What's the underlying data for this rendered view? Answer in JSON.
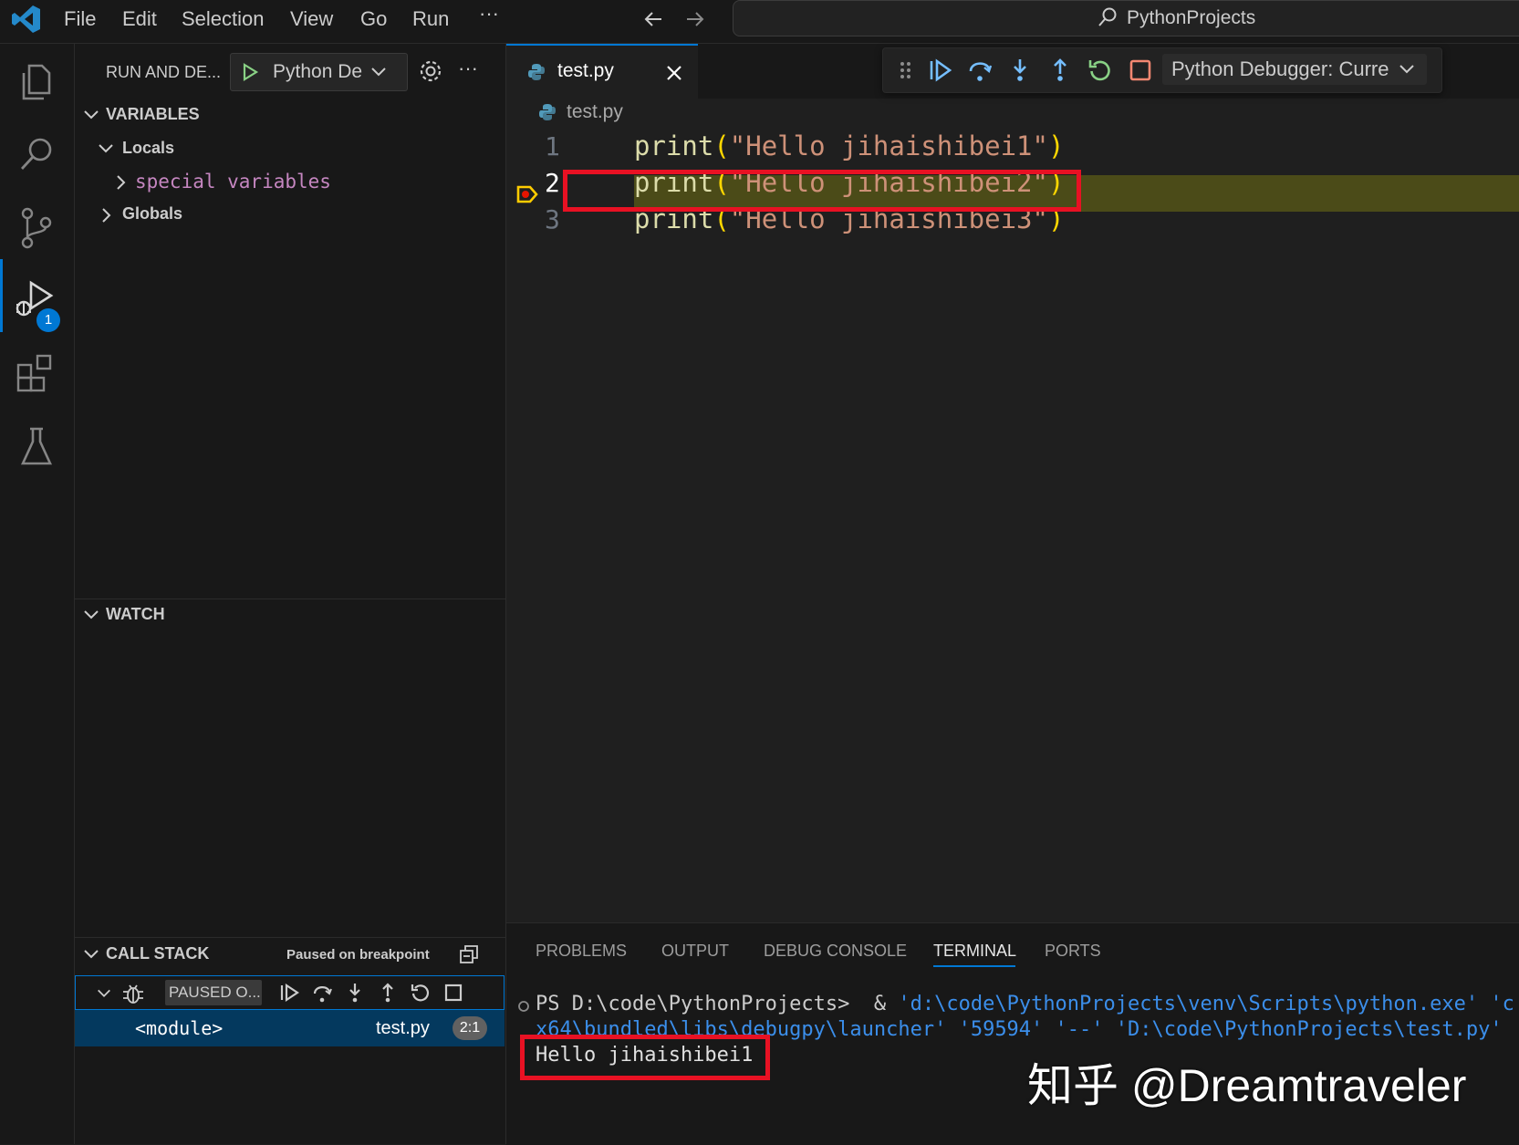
{
  "menu": {
    "file": "File",
    "edit": "Edit",
    "selection": "Selection",
    "view": "View",
    "go": "Go",
    "run": "Run",
    "more": "···"
  },
  "search": {
    "label": "PythonProjects"
  },
  "sidebar": {
    "header": "RUN AND DE...",
    "config_label": "Python De",
    "variables": {
      "title": "VARIABLES",
      "locals": "Locals",
      "special": "special variables",
      "globals": "Globals"
    },
    "watch": {
      "title": "WATCH"
    },
    "callstack": {
      "title": "CALL STACK",
      "status": "Paused on breakpoint",
      "thread_label": "PAUSED O...",
      "frame": {
        "name": "<module>",
        "file": "test.py",
        "position": "2:1"
      }
    }
  },
  "activity_badge": "1",
  "editor": {
    "tab_label": "test.py",
    "breadcrumb": "test.py",
    "debug_config": "Python Debugger: Curre",
    "lines": [
      {
        "num": "1",
        "fn": "print",
        "open": "(",
        "str": "\"Hello jihaishibei1\"",
        "close": ")"
      },
      {
        "num": "2",
        "fn": "print",
        "open": "(",
        "str": "\"Hello jihaishibei2\"",
        "close": ")"
      },
      {
        "num": "3",
        "fn": "print",
        "open": "(",
        "str": "\"Hello jihaishibei3\"",
        "close": ")"
      }
    ]
  },
  "panel": {
    "tabs": {
      "problems": "PROBLEMS",
      "output": "OUTPUT",
      "debug_console": "DEBUG CONSOLE",
      "terminal": "TERMINAL",
      "ports": "PORTS"
    },
    "terminal": {
      "prompt": "PS D:\\code\\PythonProjects>",
      "amp": "&",
      "cmd_line1": "'d:\\code\\PythonProjects\\venv\\Scripts\\python.exe' 'c:\\",
      "cmd_line2": "x64\\bundled\\libs\\debugpy\\launcher' '59594' '--' 'D:\\code\\PythonProjects\\test.py'",
      "output": "Hello jihaishibei1"
    }
  },
  "watermark": "知乎 @Dreamtraveler",
  "colors": {
    "accent": "#0078d4",
    "highlight_line": "#4b4b18",
    "annotation_red": "#e81123",
    "debug_green": "#89d185",
    "debug_blue": "#75beff"
  }
}
